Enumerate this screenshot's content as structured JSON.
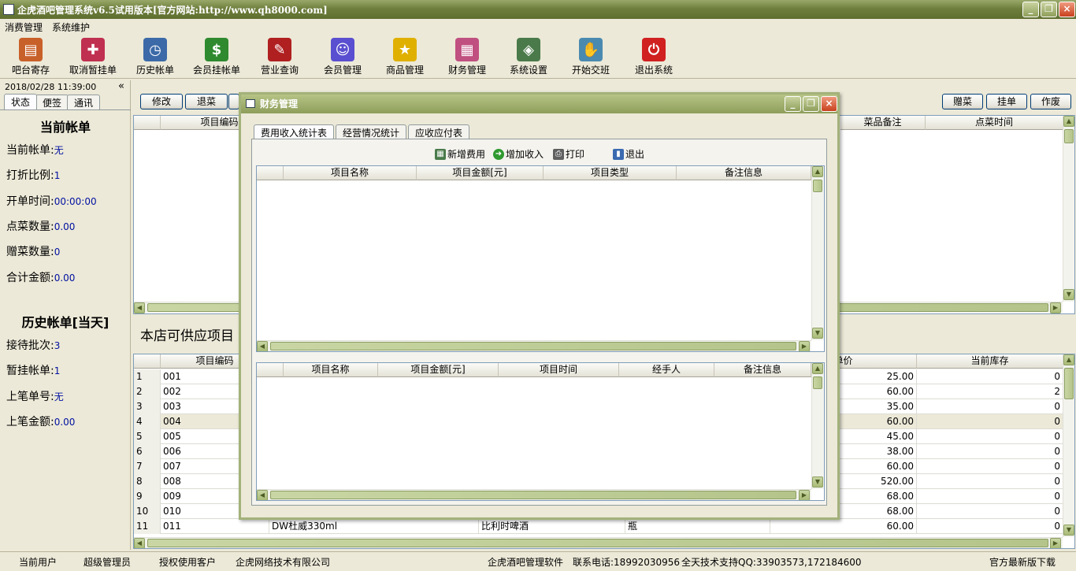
{
  "app": {
    "title": "企虎酒吧管理系统v6.5试用版本[官方网站:http://www.qh8000.com]",
    "min": "_",
    "max": "❐",
    "close": "×"
  },
  "menu": [
    "消费管理",
    "系统维护"
  ],
  "toolbar": [
    {
      "label": "吧台寄存",
      "icon": "locker-icon",
      "color": "#c8602a",
      "glyph": "▤"
    },
    {
      "label": "取消暂挂单",
      "icon": "cancel-pending-icon",
      "color": "#c03050",
      "glyph": "✚"
    },
    {
      "label": "历史帐单",
      "icon": "alarm-clock-icon",
      "color": "#3c6aa8",
      "glyph": "◷"
    },
    {
      "label": "会员挂帐单",
      "icon": "money-arrow-icon",
      "color": "#2f8a2f",
      "glyph": "$"
    },
    {
      "label": "营业查询",
      "icon": "receipt-icon",
      "color": "#b02020",
      "glyph": "✎"
    },
    {
      "label": "会员管理",
      "icon": "member-face-icon",
      "color": "#5a4fd0",
      "glyph": "☺"
    },
    {
      "label": "商品管理",
      "icon": "star-icon",
      "color": "#e0b000",
      "glyph": "★"
    },
    {
      "label": "财务管理",
      "icon": "calculator-icon",
      "color": "#c05080",
      "glyph": "▦"
    },
    {
      "label": "系统设置",
      "icon": "settings-box-icon",
      "color": "#4a7a4a",
      "glyph": "◈"
    },
    {
      "label": "开始交班",
      "icon": "handshake-icon",
      "color": "#4a8ab0",
      "glyph": "✋"
    },
    {
      "label": "退出系统",
      "icon": "power-icon",
      "color": "#d02020",
      "glyph": "⏻"
    }
  ],
  "sidebar": {
    "datetime": "2018/02/28 11:39:00",
    "collapse": "«",
    "tabs": [
      "状态",
      "便签",
      "通讯"
    ],
    "current_title": "当前帐单",
    "current": [
      {
        "label": "当前帐单:",
        "value": "无"
      },
      {
        "label": "打折比例:",
        "value": "1"
      },
      {
        "label": "开单时间:",
        "value": "00:00:00"
      },
      {
        "label": "点菜数量:",
        "value": "0.00"
      },
      {
        "label": "赠菜数量:",
        "value": "0"
      },
      {
        "label": "合计金额:",
        "value": "0.00"
      }
    ],
    "history_title": "历史帐单[当天]",
    "history": [
      {
        "label": "接待批次:",
        "value": "3"
      },
      {
        "label": "暂挂帐单:",
        "value": "1"
      },
      {
        "label": "上笔单号:",
        "value": "无"
      },
      {
        "label": "上笔金额:",
        "value": "0.00"
      }
    ]
  },
  "top_buttons_left": [
    "修改",
    "退菜"
  ],
  "top_buttons_right": [
    "赠菜",
    "挂单",
    "作废"
  ],
  "order_grid_headers": {
    "code": "项目编码",
    "remark": "菜品备注",
    "time": "点菜时间"
  },
  "supply_title": "本店可供应项目",
  "supply_headers": {
    "code": "项目编码",
    "price": "单价",
    "stock": "当前库存"
  },
  "supply_rows": [
    {
      "n": "1",
      "code": "001",
      "name": "",
      "cat": "",
      "unit": "",
      "price": "25.00",
      "stock": "0"
    },
    {
      "n": "2",
      "code": "002",
      "name": "",
      "cat": "",
      "unit": "",
      "price": "60.00",
      "stock": "2"
    },
    {
      "n": "3",
      "code": "003",
      "name": "",
      "cat": "",
      "unit": "",
      "price": "35.00",
      "stock": "0"
    },
    {
      "n": "4",
      "code": "004",
      "name": "",
      "cat": "",
      "unit": "",
      "price": "60.00",
      "stock": "0"
    },
    {
      "n": "5",
      "code": "005",
      "name": "",
      "cat": "",
      "unit": "",
      "price": "45.00",
      "stock": "0"
    },
    {
      "n": "6",
      "code": "006",
      "name": "",
      "cat": "",
      "unit": "",
      "price": "38.00",
      "stock": "0"
    },
    {
      "n": "7",
      "code": "007",
      "name": "",
      "cat": "",
      "unit": "",
      "price": "60.00",
      "stock": "0"
    },
    {
      "n": "8",
      "code": "008",
      "name": "",
      "cat": "",
      "unit": "",
      "price": "520.00",
      "stock": "0"
    },
    {
      "n": "9",
      "code": "009",
      "name": "",
      "cat": "",
      "unit": "",
      "price": "68.00",
      "stock": "0"
    },
    {
      "n": "10",
      "code": "010",
      "name": "",
      "cat": "",
      "unit": "",
      "price": "68.00",
      "stock": "0"
    },
    {
      "n": "11",
      "code": "011",
      "name": "DW杜威330ml",
      "cat": "比利时啤酒",
      "unit": "瓶",
      "price": "60.00",
      "stock": "0"
    }
  ],
  "status": [
    "当前用户",
    "超级管理员",
    "授权使用客户",
    "企虎网络技术有限公司",
    "企虎酒吧管理软件",
    "联系电话:18992030956",
    "全天技术支持QQ:33903573,172184600",
    "官方最新版下载"
  ],
  "dialog": {
    "title": "财务管理",
    "tabs": [
      "费用收入统计表",
      "经营情况统计",
      "应收应付表"
    ],
    "tools": [
      {
        "label": "新增费用",
        "icon": "add-expense-icon",
        "color": "#4a7a4a"
      },
      {
        "label": "增加收入",
        "icon": "add-income-icon",
        "color": "#2f9a2f"
      },
      {
        "label": "打印",
        "icon": "printer-icon",
        "color": "#606060"
      },
      {
        "label": "退出",
        "icon": "exit-door-icon",
        "color": "#3a6ab0"
      }
    ],
    "expense_headers": [
      "项目名称",
      "项目金额[元]",
      "项目类型",
      "备注信息"
    ],
    "income_headers": [
      "项目名称",
      "项目金额[元]",
      "项目时间",
      "经手人",
      "备注信息"
    ]
  }
}
